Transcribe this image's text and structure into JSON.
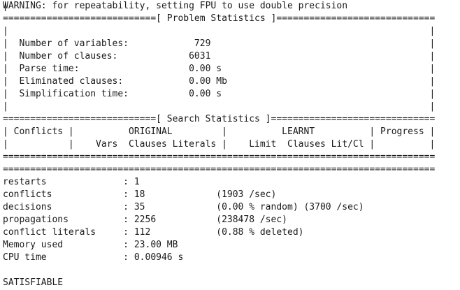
{
  "console": {
    "lines": [
      "WARNING: for repeatability, setting FPU to use double precision",
      "============================[ Problem Statistics ]=============================",
      "|                                                                             |",
      "|  Number of variables:            729                                        |",
      "|  Number of clauses:             6031                                        |",
      "|  Parse time:                    0.00 s                                      |",
      "|  Eliminated clauses:            0.00 Mb                                     |",
      "|  Simplification time:           0.00 s                                      |",
      "|                                                                             |",
      "============================[ Search Statistics ]==============================",
      "| Conflicts |          ORIGINAL         |          LEARNT          | Progress |",
      "|           |    Vars  Clauses Literals |    Limit  Clauses Lit/Cl |          |",
      "===============================================================================",
      "===============================================================================",
      "restarts              : 1",
      "conflicts             : 18             (1903 /sec)",
      "decisions             : 35             (0.00 % random) (3700 /sec)",
      "propagations          : 2256           (238478 /sec)",
      "conflict literals     : 112            (0.88 % deleted)",
      "Memory used           : 23.00 MB",
      "CPU time              : 0.00946 s",
      "",
      "SATISFIABLE"
    ]
  }
}
